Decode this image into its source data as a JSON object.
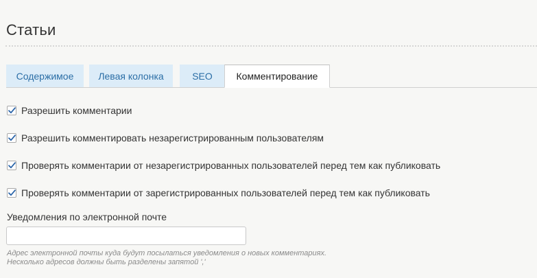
{
  "header": {
    "title": "Статьи"
  },
  "tabs": [
    {
      "label": "Содержимое",
      "active": false
    },
    {
      "label": "Левая колонка",
      "active": false
    },
    {
      "label": "SEO",
      "active": false
    },
    {
      "label": "Комментирование",
      "active": true
    }
  ],
  "options": [
    {
      "label": "Разрешить комментарии",
      "checked": true
    },
    {
      "label": "Разрешить комментировать незарегистрированным пользователям",
      "checked": true
    },
    {
      "label": "Проверять комментарии от незарегистрированных пользователей перед тем как публиковать",
      "checked": true
    },
    {
      "label": "Проверять комментарии от зарегистрированных пользователей перед тем как публиковать",
      "checked": true
    }
  ],
  "email": {
    "label": "Уведомления по электронной почте",
    "value": "",
    "placeholder": "",
    "hint_line1": "Адрес электронной почты куда будут посылаться уведомления о новых комментариях.",
    "hint_line2": "Несколько адресов должны быть разделены запятой ','"
  },
  "colors": {
    "tab_bg": "#dcecf8",
    "tab_text": "#2b6ea6",
    "active_tab_bg": "#ffffff",
    "checkmark": "#2a64a8",
    "page_bg": "#f7f7f5"
  }
}
